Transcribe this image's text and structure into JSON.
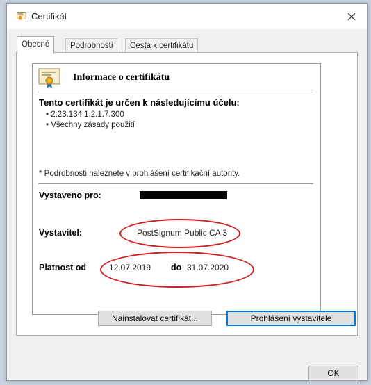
{
  "window": {
    "title": "Certifikát",
    "tabs": [
      {
        "label": "Obecné",
        "active": true
      },
      {
        "label": "Podrobnosti",
        "active": false
      },
      {
        "label": "Cesta k certifikátu",
        "active": false
      }
    ]
  },
  "info": {
    "title": "Informace o certifikátu",
    "purpose_heading": "Tento certifikát je určen k následujícímu účelu:",
    "purposes": [
      "• 2.23.134.1.2.1.7.300",
      "• Všechny zásady použití"
    ],
    "footnote": "* Podrobnosti naleznete v prohlášení certifikační autority.",
    "issued_to_label": "Vystaveno pro:",
    "issuer_label": "Vystavitel:",
    "issuer_value": "PostSignum Public CA 3",
    "validity_from_label": "Platnost od",
    "validity_from": "12.07.2019",
    "validity_to_label": "do",
    "validity_to": "31.07.2020"
  },
  "buttons": {
    "install": "Nainstalovat certifikát...",
    "statement": "Prohlášení vystavitele",
    "ok": "OK"
  },
  "colors": {
    "annotation": "#d11c1c",
    "focus": "#0078d7"
  },
  "icons": {
    "title": "certificate-icon",
    "close": "close-icon",
    "info": "certificate-icon"
  }
}
